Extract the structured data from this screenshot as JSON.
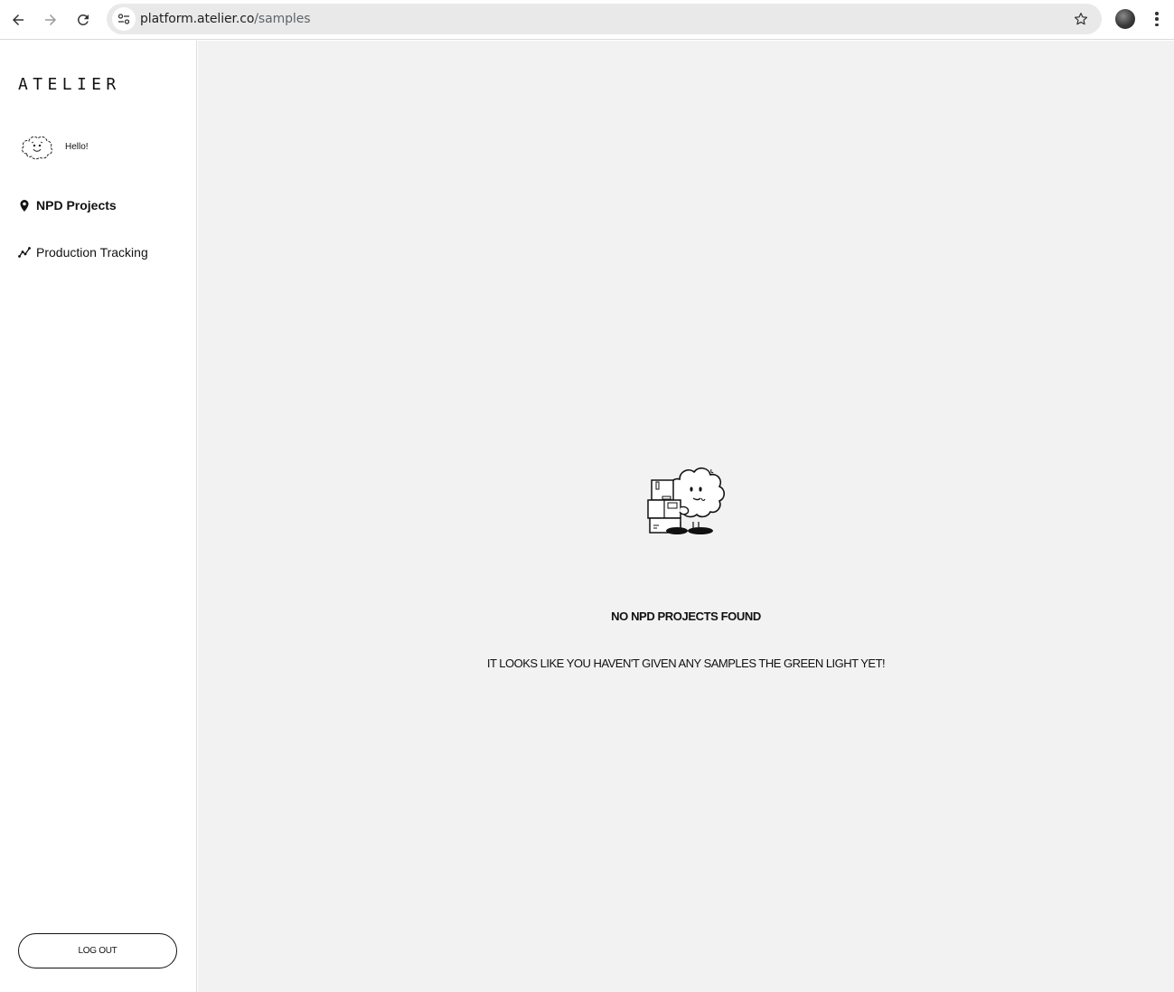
{
  "browser": {
    "url_host": "platform.atelier.co",
    "url_path": "/samples"
  },
  "sidebar": {
    "brand": "ATELIER",
    "greeting": "Hello!",
    "items": [
      {
        "label": "NPD Projects",
        "icon": "map-pin-icon",
        "active": true
      },
      {
        "label": "Production Tracking",
        "icon": "line-chart-icon",
        "active": false
      }
    ],
    "logout_label": "LOG OUT"
  },
  "main": {
    "empty_title": "NO NPD PROJECTS FOUND",
    "empty_message": "IT LOOKS LIKE YOU HAVEN'T GIVEN ANY SAMPLES THE GREEN LIGHT YET!"
  },
  "colors": {
    "main_background": "#f2f2f2",
    "sidebar_background": "#ffffff",
    "text": "#111111"
  }
}
